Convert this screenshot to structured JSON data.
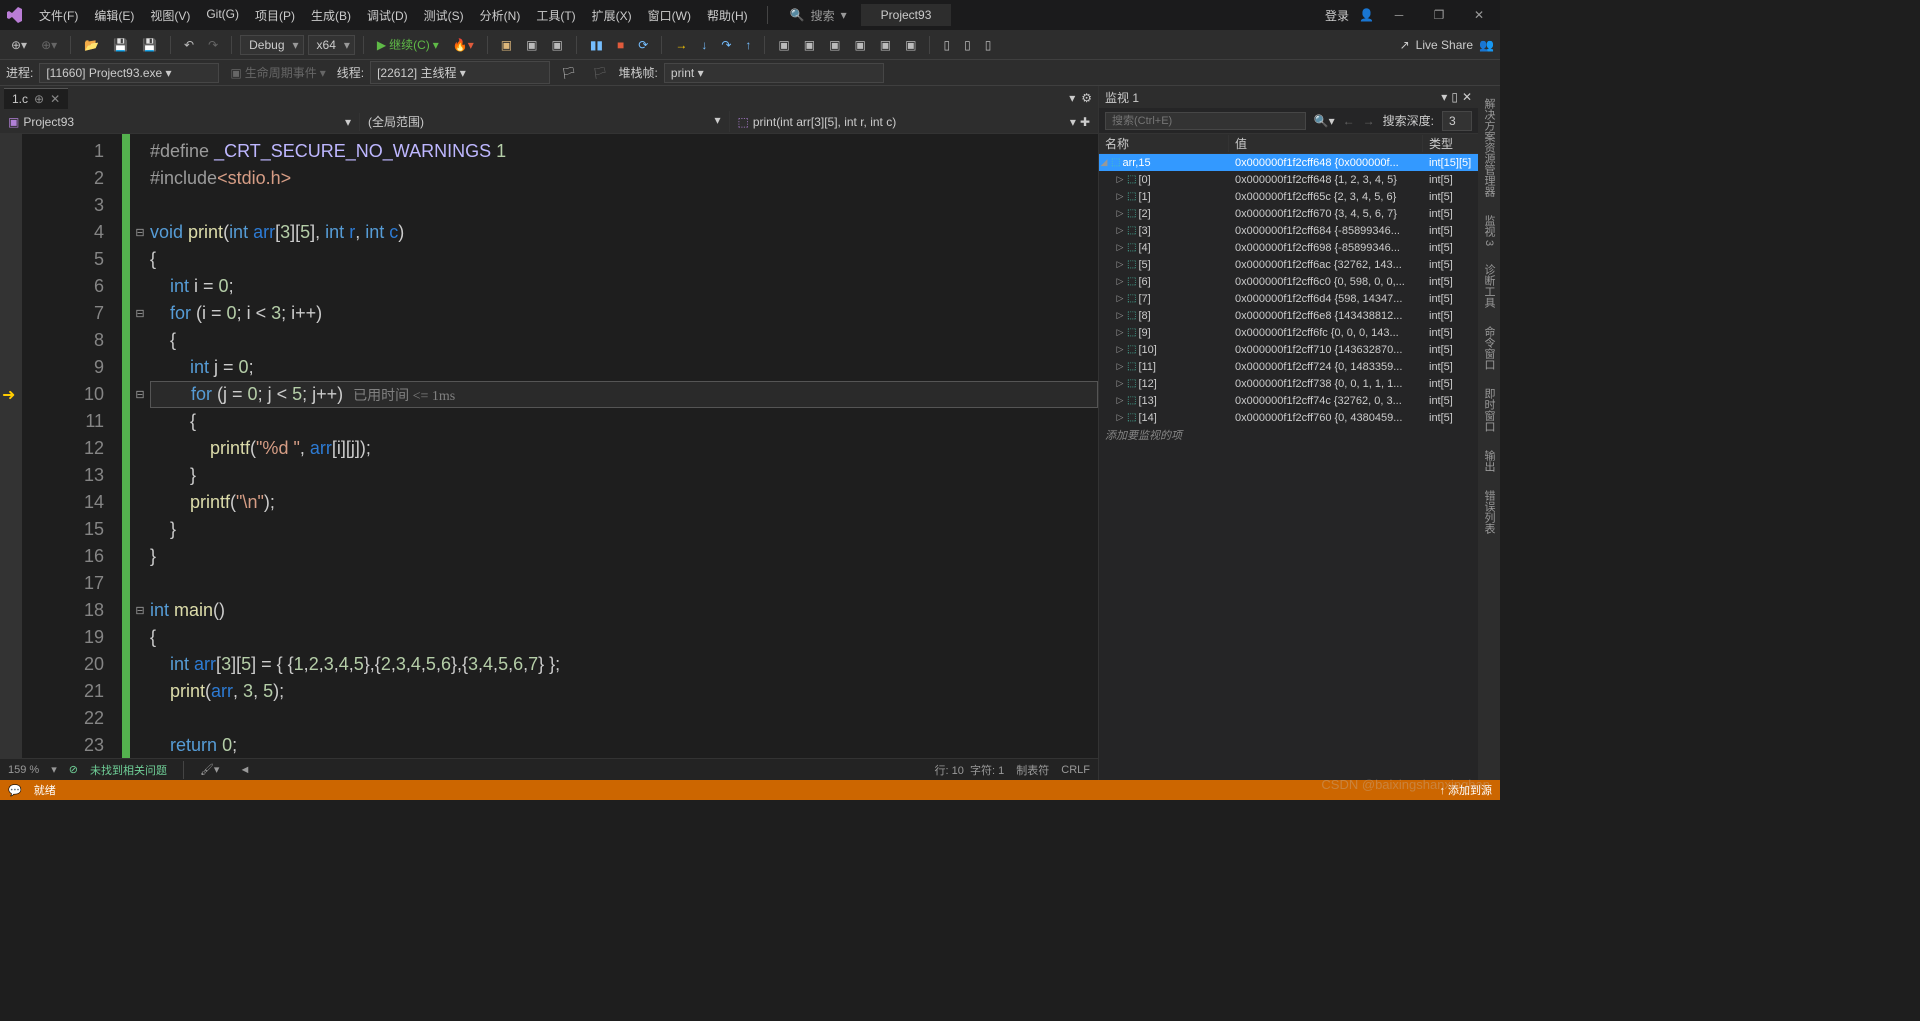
{
  "titlebar": {
    "menus": [
      "文件(F)",
      "编辑(E)",
      "视图(V)",
      "Git(G)",
      "项目(P)",
      "生成(B)",
      "调试(D)",
      "测试(S)",
      "分析(N)",
      "工具(T)",
      "扩展(X)",
      "窗口(W)",
      "帮助(H)"
    ],
    "search": "搜索",
    "project": "Project93",
    "login": "登录"
  },
  "toolbar": {
    "config": "Debug",
    "platform": "x64",
    "continue": "继续(C)",
    "liveshare": "Live Share"
  },
  "toolbar2": {
    "process_label": "进程:",
    "process": "[11660] Project93.exe",
    "lifecycle": "生命周期事件",
    "thread_label": "线程:",
    "thread": "[22612] 主线程",
    "stackframe": "堆栈帧:",
    "stackval": "print"
  },
  "tabs": {
    "file": "1.c"
  },
  "nav": {
    "proj": "Project93",
    "scope": "(全局范围)",
    "func": "print(int arr[3][5], int r, int c)"
  },
  "hint": "已用时间 <= 1ms",
  "status": {
    "zoom": "159 %",
    "issues": "未找到相关问题",
    "line": "行: 10",
    "col": "字符: 1",
    "tabs": "制表符",
    "encoding": "CRLF"
  },
  "watch": {
    "title": "监视 1",
    "placeholder": "搜索(Ctrl+E)",
    "depth_label": "搜索深度:",
    "depth": "3",
    "cols": {
      "name": "名称",
      "value": "值",
      "type": "类型"
    },
    "root": {
      "name": "arr,15",
      "value": "0x000000f1f2cff648 {0x000000f...",
      "type": "int[15][5]"
    },
    "rows": [
      {
        "name": "[0]",
        "value": "0x000000f1f2cff648 {1, 2, 3, 4, 5}",
        "type": "int[5]"
      },
      {
        "name": "[1]",
        "value": "0x000000f1f2cff65c {2, 3, 4, 5, 6}",
        "type": "int[5]"
      },
      {
        "name": "[2]",
        "value": "0x000000f1f2cff670 {3, 4, 5, 6, 7}",
        "type": "int[5]"
      },
      {
        "name": "[3]",
        "value": "0x000000f1f2cff684 {-85899346...",
        "type": "int[5]"
      },
      {
        "name": "[4]",
        "value": "0x000000f1f2cff698 {-85899346...",
        "type": "int[5]"
      },
      {
        "name": "[5]",
        "value": "0x000000f1f2cff6ac {32762, 143...",
        "type": "int[5]"
      },
      {
        "name": "[6]",
        "value": "0x000000f1f2cff6c0 {0, 598, 0, 0,...",
        "type": "int[5]"
      },
      {
        "name": "[7]",
        "value": "0x000000f1f2cff6d4 {598, 14347...",
        "type": "int[5]"
      },
      {
        "name": "[8]",
        "value": "0x000000f1f2cff6e8 {143438812...",
        "type": "int[5]"
      },
      {
        "name": "[9]",
        "value": "0x000000f1f2cff6fc {0, 0, 0, 143...",
        "type": "int[5]"
      },
      {
        "name": "[10]",
        "value": "0x000000f1f2cff710 {143632870...",
        "type": "int[5]"
      },
      {
        "name": "[11]",
        "value": "0x000000f1f2cff724 {0, 1483359...",
        "type": "int[5]"
      },
      {
        "name": "[12]",
        "value": "0x000000f1f2cff738 {0, 0, 1, 1, 1...",
        "type": "int[5]"
      },
      {
        "name": "[13]",
        "value": "0x000000f1f2cff74c {32762, 0, 3...",
        "type": "int[5]"
      },
      {
        "name": "[14]",
        "value": "0x000000f1f2cff760 {0, 4380459...",
        "type": "int[5]"
      }
    ],
    "addnew": "添加要监视的项"
  },
  "sidetabs": [
    "解决方案资源管理器",
    "监视 3",
    "诊断工具",
    "命令窗口",
    "即时窗口",
    "输出",
    "错误列表"
  ],
  "statusbar": {
    "ready": "就绪",
    "addrepo": "添加到源"
  }
}
